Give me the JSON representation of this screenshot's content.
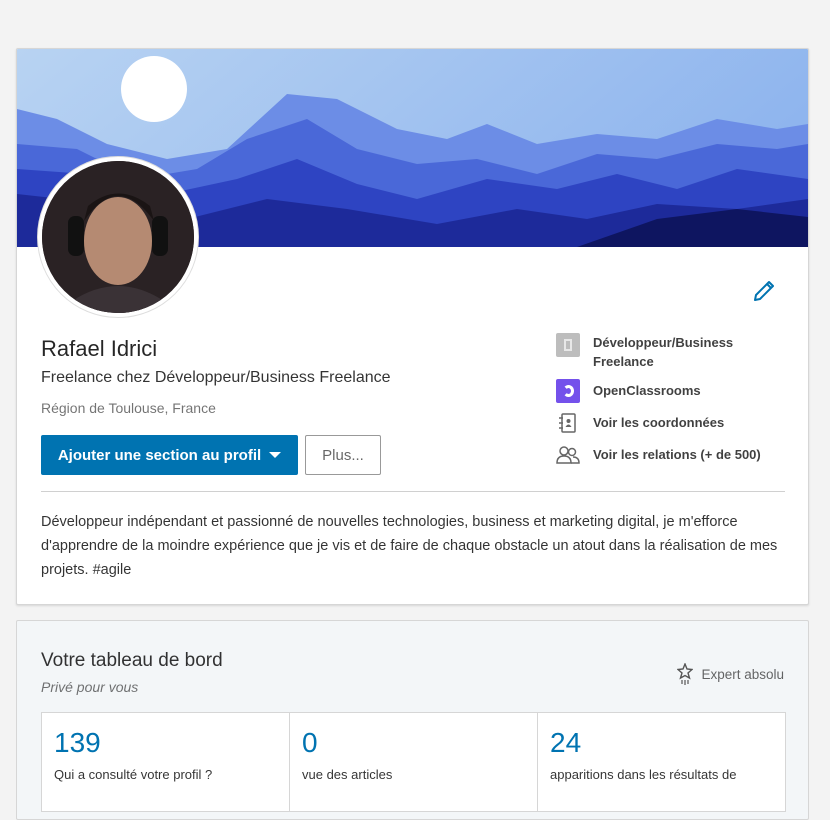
{
  "profile": {
    "name": "Rafael Idrici",
    "headline": "Freelance chez Développeur/Business Freelance",
    "location": "Région de Toulouse, France",
    "add_section_label": "Ajouter une section au profil",
    "more_label": "Plus...",
    "summary": "Développeur indépendant et passionné de nouvelles technologies, business et marketing digital, je m'efforce d'apprendre de la moindre expérience que je vis et de faire de chaque obstacle un atout dans la réalisation de mes projets. #agile",
    "side": {
      "company": "Développeur/Business Freelance",
      "school": "OpenClassrooms",
      "contact": "Voir les coordonnées",
      "connections": "Voir les relations (+ de 500)"
    }
  },
  "dashboard": {
    "title": "Votre tableau de bord",
    "subtitle": "Privé pour vous",
    "level": "Expert absolu",
    "stats": [
      {
        "value": "139",
        "label": "Qui a consulté votre profil ?"
      },
      {
        "value": "0",
        "label": "vue des articles"
      },
      {
        "value": "24",
        "label": "apparitions dans les résultats de"
      }
    ]
  },
  "colors": {
    "accent": "#0073b1",
    "openclassrooms": "#7451eb"
  }
}
